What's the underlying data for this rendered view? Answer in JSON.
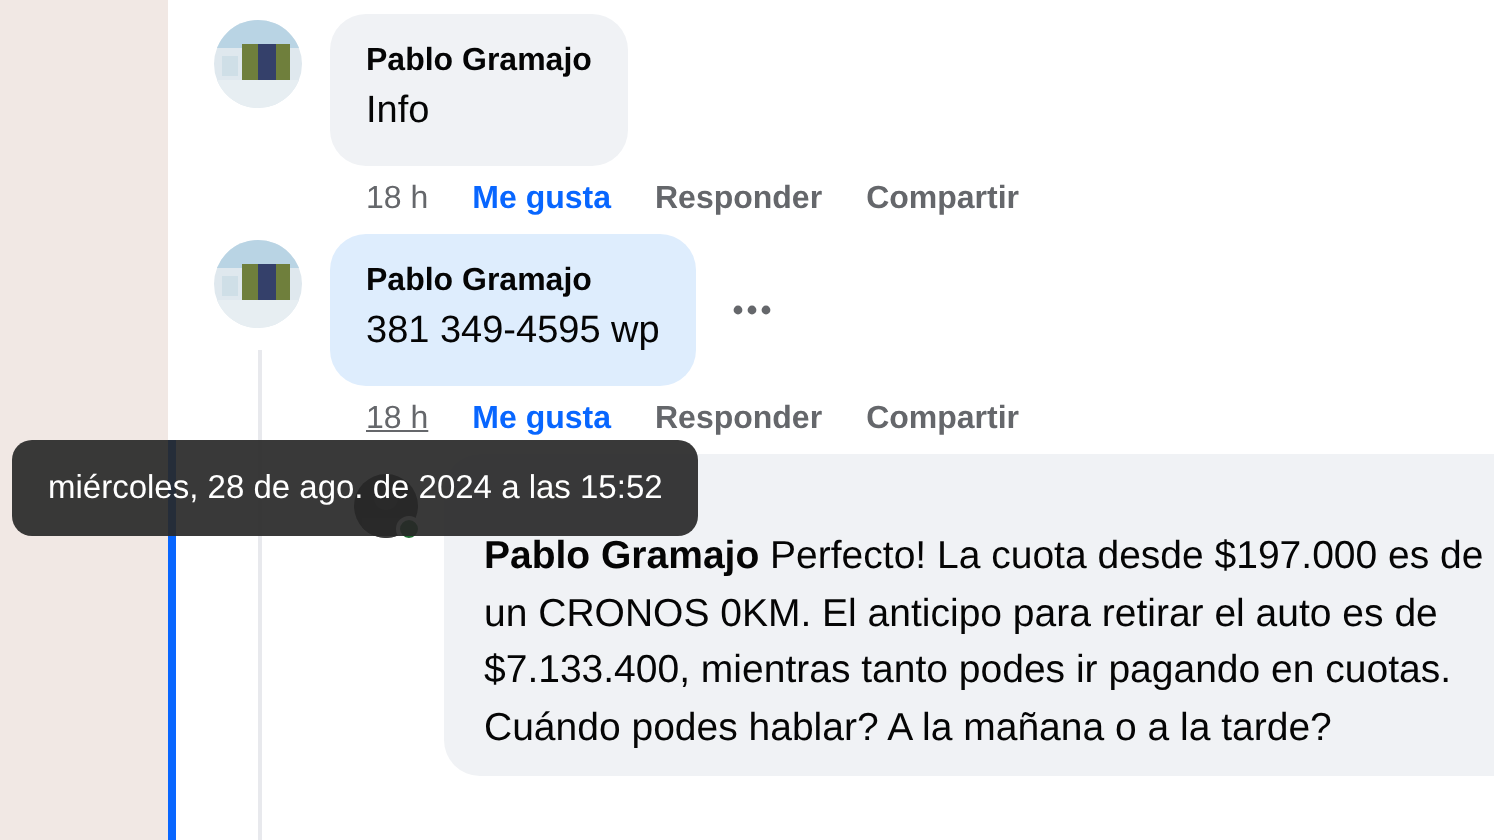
{
  "comments": [
    {
      "author": "Pablo Gramajo",
      "text": "Info",
      "time": "18 h",
      "time_hovered": false,
      "like": "Me gusta",
      "reply": "Responder",
      "share": "Compartir",
      "bubble_highlighted": false,
      "show_more": false
    },
    {
      "author": "Pablo Gramajo",
      "text": "381 349-4595 wp",
      "time": "18 h",
      "time_hovered": true,
      "like": "Me gusta",
      "reply": "Responder",
      "share": "Compartir",
      "bubble_highlighted": true,
      "show_more": true
    }
  ],
  "reply": {
    "online": true,
    "text": "**Pablo Gramajo** Perfecto! La cuota desde $197.000 es de un CRONOS 0KM. El anticipo para retirar el auto es de $7.133.400, mientras tanto podes ir pagando en cuotas. Cuándo podes hablar? A la mañana o a la tarde?"
  },
  "tooltip": "miércoles, 28 de ago. de 2024 a las 15:52"
}
